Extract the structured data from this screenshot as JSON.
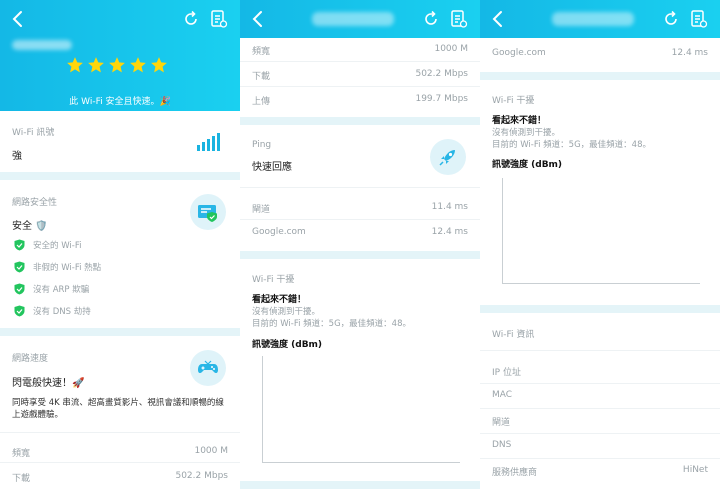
{
  "panel1": {
    "header": {
      "back_icon": "chevron-left-icon",
      "refresh_icon": "refresh-icon",
      "report_icon": "report-icon"
    },
    "hero": {
      "stars": 5,
      "safe_message": "此 Wi-Fi 安全且快速。🎉"
    },
    "wifi_signal": {
      "label": "Wi-Fi 訊號",
      "value": "強"
    },
    "security": {
      "label": "網路安全性",
      "value": "安全 🛡️",
      "checks": [
        "安全的 Wi-Fi",
        "非假的 Wi-Fi 熱點",
        "沒有 ARP 欺騙",
        "沒有 DNS 劫持"
      ]
    },
    "speed": {
      "label": "網路速度",
      "title": "閃電般快速！🚀",
      "desc_line1": "同時享受 4K 串流、超高畫質影片、視訊會議和順暢的線",
      "desc_line2": "上遊戲體驗。",
      "rows": [
        {
          "label": "頻寬",
          "value": "1000 M"
        },
        {
          "label": "下載",
          "value": "502.2 Mbps"
        }
      ]
    }
  },
  "panel2": {
    "rows_top": [
      {
        "label": "頻寬",
        "value": "1000 M"
      },
      {
        "label": "下載",
        "value": "502.2 Mbps"
      },
      {
        "label": "上傳",
        "value": "199.7 Mbps"
      }
    ],
    "ping": {
      "label": "Ping",
      "value": "快速回應",
      "rows": [
        {
          "label": "閘道",
          "value": "11.4 ms"
        },
        {
          "label": "Google.com",
          "value": "12.4 ms"
        }
      ]
    },
    "interference": {
      "label": "Wi-Fi 干擾",
      "title": "看起來不錯！",
      "line1": "沒有偵測到干擾。",
      "line2": "目前的 Wi-Fi 頻道：5G，最佳頻道：48。",
      "signal_label": "訊號強度 (dBm)"
    }
  },
  "panel3": {
    "google_row": {
      "label": "Google.com",
      "value": "12.4 ms"
    },
    "interference": {
      "label": "Wi-Fi 干擾",
      "title": "看起來不錯！",
      "line1": "沒有偵測到干擾。",
      "line2": "目前的 Wi-Fi 頻道：5G，最佳頻道：48。",
      "signal_label": "訊號強度 (dBm)"
    },
    "info": {
      "label": "Wi-Fi 資訊",
      "rows": [
        {
          "label": "IP 位址",
          "value": ""
        },
        {
          "label": "MAC",
          "value": ""
        },
        {
          "label": "閘道",
          "value": ""
        },
        {
          "label": "DNS",
          "value": ""
        },
        {
          "label": "服務供應商",
          "value": "HiNet"
        }
      ]
    }
  },
  "colors": {
    "header": "#14b8e6",
    "accent": "#1ab3e0",
    "check": "#22c55e",
    "star": "#ffd60a"
  }
}
